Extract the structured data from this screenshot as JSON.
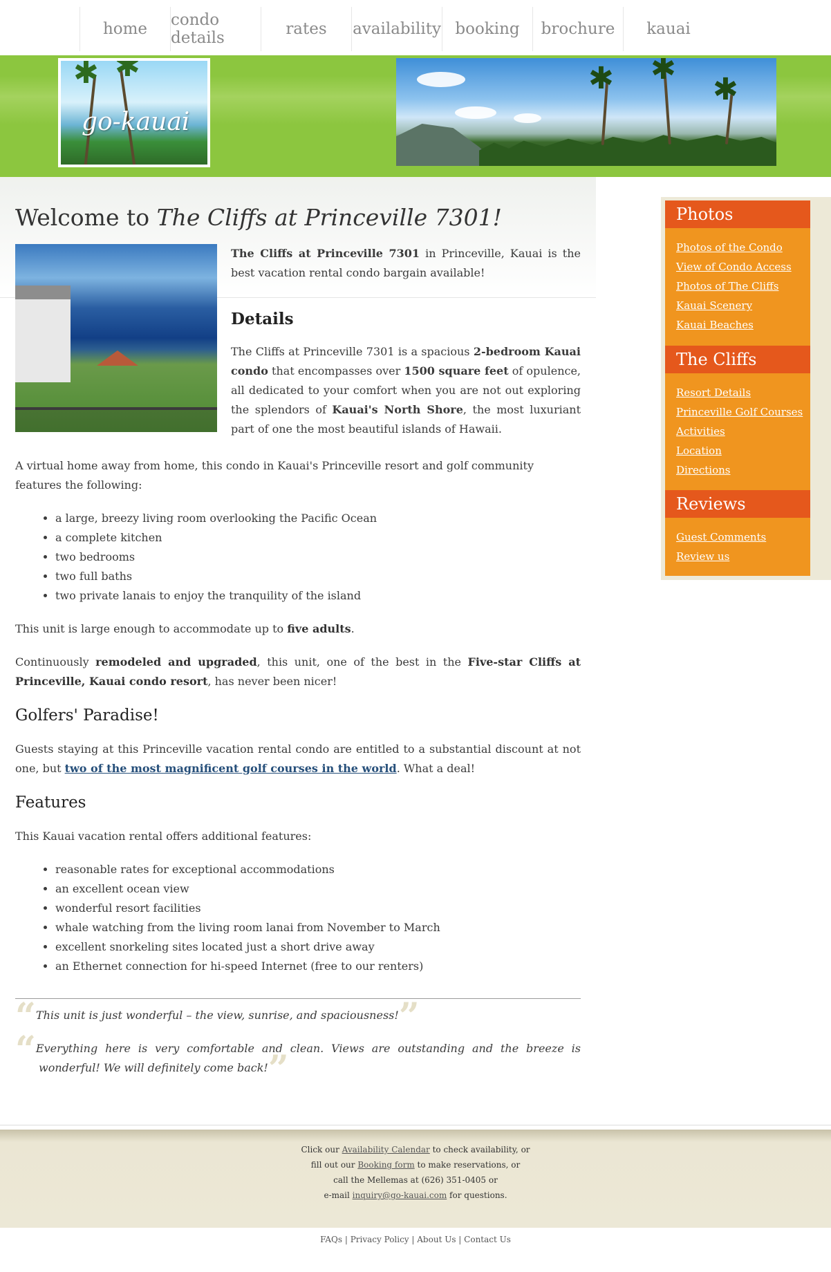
{
  "nav": {
    "items": [
      "home",
      "condo details",
      "rates",
      "availability",
      "booking",
      "brochure",
      "kauai"
    ]
  },
  "header": {
    "logo_text": "go-kauai"
  },
  "main": {
    "welcome_prefix": "Welcome to ",
    "welcome_italic": "The Cliffs at Princeville 7301!",
    "intro_bold": "The Cliffs at Princeville  7301",
    "intro_rest": " in Princeville, Kauai is the best vacation rental condo bargain available!",
    "details_heading": "Details",
    "details_p": {
      "t1": "The Cliffs at Princeville 7301 is a spacious ",
      "b1": "2-bedroom Kauai condo",
      "t2": " that encompasses over ",
      "b2": "1500 square feet",
      "t3": " of opulence, all dedicated to your comfort when you are not out exploring the splendors of ",
      "b3": "Kauai's North Shore",
      "t4": ", the most luxuriant part of one the most beautiful islands of Hawaii."
    },
    "virtual_home": "A virtual home away from home, this condo in Kauai's Princeville resort and golf community features the following:",
    "amenities": [
      "a large, breezy living room overlooking the Pacific Ocean",
      "a complete kitchen",
      "two bedrooms",
      "two full baths",
      "two private lanais to enjoy the tranquility of the island"
    ],
    "accommodate": {
      "t1": "This unit is large enough to accommodate up to ",
      "b1": "five adults",
      "t2": "."
    },
    "remodeled": {
      "t1": "Continuously ",
      "b1": "remodeled and upgraded",
      "t2": ", this unit, one of the best in the ",
      "b2": "Five-star Cliffs at Princeville, Kauai condo resort",
      "t3": ", has never been nicer!"
    },
    "golf_heading": "Golfers' Paradise!",
    "golf": {
      "t1": "Guests staying at this Princeville vacation rental condo are entitled to a substantial discount at not one, but ",
      "link": "two of the most magnificent golf courses in the world",
      "t2": ". What a deal!"
    },
    "features_heading": "Features",
    "features_intro": "This Kauai vacation rental offers additional features:",
    "features": [
      "reasonable rates for exceptional accommodations",
      "an excellent ocean view",
      "wonderful resort facilities",
      "whale watching from the living room lanai from November to March",
      "excellent snorkeling sites located just a short drive away",
      "an Ethernet connection for hi-speed Internet (free to our renters)"
    ],
    "quotes": [
      "This unit is just wonderful – the view, sunrise, and spaciousness!",
      "Everything here is very comfortable and clean. Views are outstanding and the breeze is wonderful! We will definitely come back!"
    ]
  },
  "sidebar": {
    "sections": [
      {
        "title": "Photos",
        "links": [
          "Photos of the Condo",
          "View of Condo Access",
          "Photos of The Cliffs",
          "Kauai Scenery",
          "Kauai Beaches"
        ]
      },
      {
        "title": "The Cliffs",
        "links": [
          "Resort Details",
          "Princeville Golf Courses",
          "Activities",
          "Location",
          "Directions"
        ]
      },
      {
        "title": "Reviews",
        "links": [
          "Guest Comments",
          "Review us"
        ]
      }
    ]
  },
  "footer": {
    "l1a": "Click our ",
    "l1link": "Availability Calendar",
    "l1b": " to check availability, or",
    "l2a": "fill out our ",
    "l2link": "Booking form",
    "l2b": " to make reservations, or",
    "l3": "call the Mellemas at (626) 351-0405 or",
    "l4a": "e-mail ",
    "l4link": "inquiry@go-kauai.com",
    "l4b": " for questions.",
    "bottom_links": [
      "FAQs",
      "Privacy Policy",
      "About Us",
      "Contact Us"
    ],
    "separator": " | "
  },
  "colors": {
    "green_band": "#8cc63f",
    "sidebar_orange": "#f0951f",
    "sidebar_header": "#e5581c",
    "sidebar_bg": "#ede9d7",
    "footer_bg": "#ece8d6",
    "link_blue": "#264f7a"
  }
}
